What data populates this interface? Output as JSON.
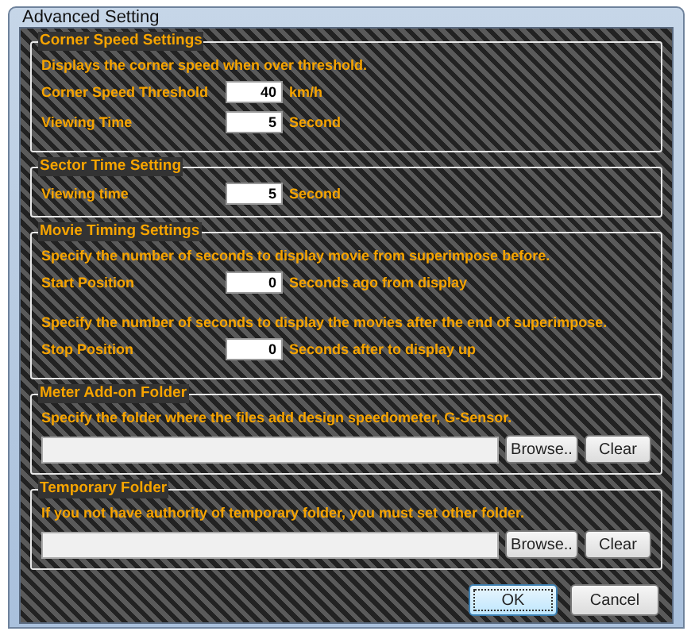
{
  "window": {
    "title": "Advanced Setting"
  },
  "groups": [
    {
      "title": "Corner Speed Settings",
      "items": [
        {
          "kind": "text",
          "text": "Displays the corner speed when over threshold."
        },
        {
          "kind": "number",
          "label": "Corner Speed Threshold",
          "value": "40",
          "unit": "km/h"
        },
        {
          "kind": "number",
          "label": "Viewing Time",
          "value": "5",
          "unit": "Second"
        }
      ]
    },
    {
      "title": "Sector Time Setting",
      "items": [
        {
          "kind": "number",
          "label": "Viewing time",
          "value": "5",
          "unit": "Second"
        }
      ]
    },
    {
      "title": "Movie Timing Settings",
      "items": [
        {
          "kind": "text",
          "text": "Specify the number of seconds to display movie from superimpose before."
        },
        {
          "kind": "number",
          "label": "Start Position",
          "value": "0",
          "unit": "Seconds ago from display"
        },
        {
          "kind": "text",
          "text": "Specify the number of seconds to display the movies after the end of superimpose."
        },
        {
          "kind": "number",
          "label": "Stop Position",
          "value": "0",
          "unit": "Seconds after to display up"
        }
      ]
    },
    {
      "title": "Meter Add-on Folder",
      "items": [
        {
          "kind": "text",
          "text": "Specify the folder where the files add design speedometer, G-Sensor."
        },
        {
          "kind": "folder",
          "buttons": [
            "Browse..",
            "Clear"
          ]
        }
      ]
    },
    {
      "title": "Temporary Folder",
      "items": [
        {
          "kind": "text",
          "text": "If you not have authority of temporary folder, you must set other folder."
        },
        {
          "kind": "folder",
          "buttons": [
            "Browse..",
            "Clear"
          ]
        }
      ]
    }
  ],
  "buttons": [
    {
      "label": "OK",
      "focused": true
    },
    {
      "label": "Cancel",
      "focused": false
    }
  ]
}
